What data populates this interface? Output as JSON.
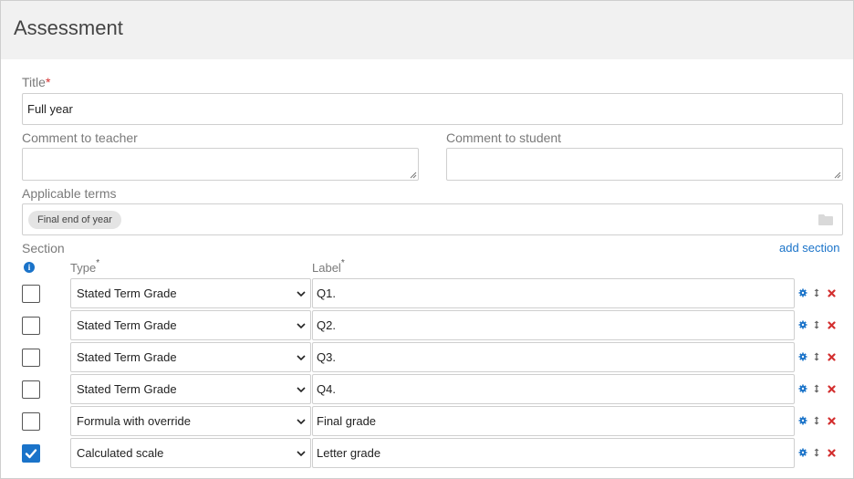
{
  "header": {
    "title": "Assessment"
  },
  "form": {
    "title_label": "Title",
    "title_required_mark": "*",
    "title_value": "Full year",
    "comment_teacher_label": "Comment to teacher",
    "comment_student_label": "Comment to student",
    "applicable_terms_label": "Applicable terms",
    "terms_chips": [
      "Final end of year"
    ]
  },
  "section": {
    "label": "Section",
    "add_link": "add section",
    "col_type": "Type",
    "col_label": "Label",
    "required_mark": "*",
    "info_glyph": "i",
    "rows": [
      {
        "checked": false,
        "type": "Stated Term Grade",
        "label": "Q1."
      },
      {
        "checked": false,
        "type": "Stated Term Grade",
        "label": "Q2."
      },
      {
        "checked": false,
        "type": "Stated Term Grade",
        "label": "Q3."
      },
      {
        "checked": false,
        "type": "Stated Term Grade",
        "label": "Q4."
      },
      {
        "checked": false,
        "type": "Formula with override",
        "label": "Final grade"
      },
      {
        "checked": true,
        "type": "Calculated scale",
        "label": "Letter grade"
      }
    ]
  },
  "icons": {
    "info": "info-icon",
    "folder": "folder-icon",
    "settings": "gear-icon",
    "reorder": "drag-handle-icon",
    "delete": "close-icon"
  },
  "colors": {
    "accent": "#1a73c9",
    "danger": "#d32f2f",
    "header_bg": "#f1f1f1"
  }
}
